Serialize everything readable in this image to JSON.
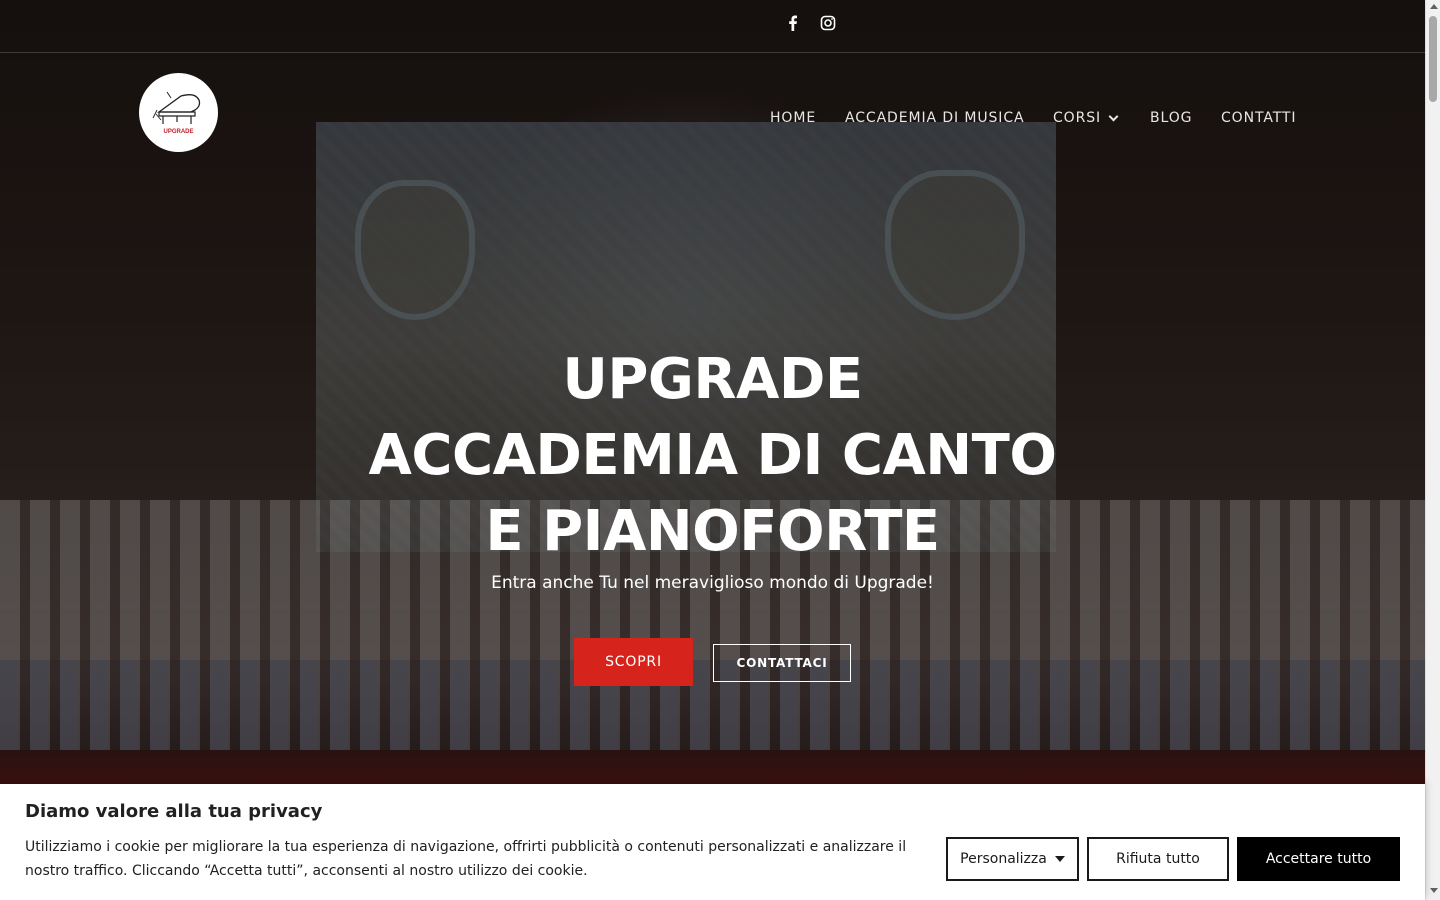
{
  "social": [
    {
      "icon": "facebook-icon"
    },
    {
      "icon": "instagram-icon"
    }
  ],
  "logo": {
    "text": "UPGRADE"
  },
  "nav": {
    "items": [
      "HOME",
      "ACCADEMIA DI MUSICA",
      "CORSI",
      "BLOG",
      "CONTATTI"
    ]
  },
  "hero": {
    "title_lines": [
      "UPGRADE",
      "ACCADEMIA DI CANTO",
      "E PIANOFORTE"
    ],
    "subtitle": "Entra anche Tu nel meraviglioso mondo di Upgrade!",
    "primary_button": "SCOPRI",
    "secondary_button": "CONTATTACI"
  },
  "cookie": {
    "title": "Diamo valore alla tua privacy",
    "text": "Utilizziamo i cookie per migliorare la tua esperienza di navigazione, offrirti pubblicità o contenuti personalizzati e analizzare il nostro traffico. Cliccando “Accetta tutti”, acconsenti al nostro utilizzo dei cookie.",
    "customize": "Personalizza",
    "reject": "Rifiuta tutto",
    "accept": "Accettare tutto"
  },
  "colors": {
    "accent_red": "#d6231b",
    "cookie_accept_bg": "#000000"
  }
}
